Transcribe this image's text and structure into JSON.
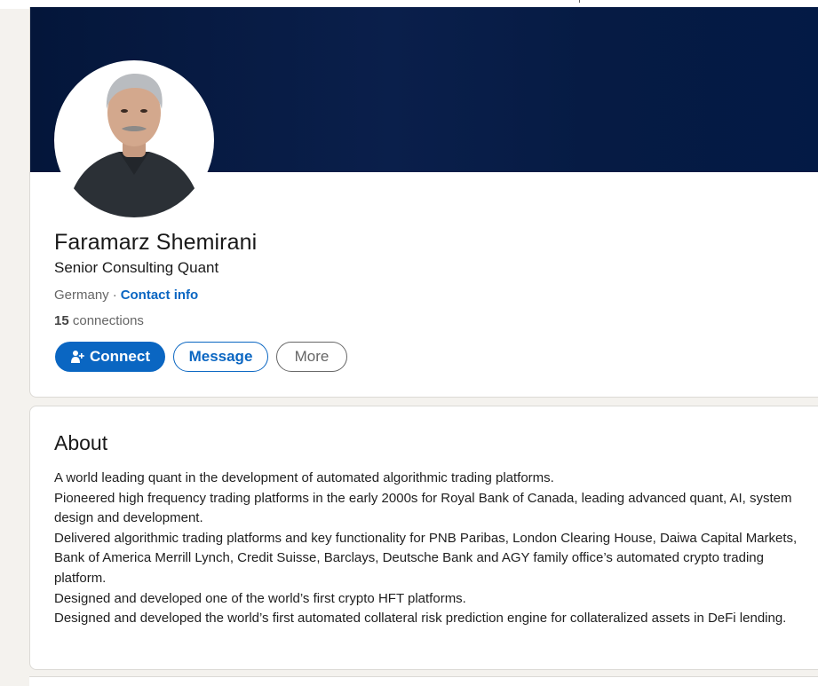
{
  "profile": {
    "name": "Faramarz Shemirani",
    "headline": "Senior Consulting Quant",
    "location": "Germany",
    "separator": "·",
    "contact_info_label": "Contact info",
    "connections_count": "15",
    "connections_label": "connections"
  },
  "actions": {
    "connect_label": "Connect",
    "message_label": "Message",
    "more_label": "More"
  },
  "about": {
    "title": "About",
    "paragraphs": [
      "A world leading quant in the development of automated algorithmic trading platforms.",
      "Pioneered high frequency trading platforms in the early 2000s for Royal Bank of Canada, leading advanced quant, AI, system design and development.",
      "Delivered algorithmic trading platforms and key functionality for PNB Paribas, London Clearing House, Daiwa Capital Markets, Bank of America Merrill Lynch, Credit Suisse, Barclays, Deutsche Bank and AGY family office’s automated crypto trading platform.",
      "Designed and developed one of the world’s first crypto HFT platforms.",
      "Designed and developed the world’s first automated collateral risk prediction engine for collateralized assets in DeFi lending."
    ]
  },
  "icons": {
    "connect": "add-person-icon"
  },
  "colors": {
    "primary": "#0a66c2",
    "banner": "#0a1f4b",
    "page_bg": "#f4f2ee"
  }
}
